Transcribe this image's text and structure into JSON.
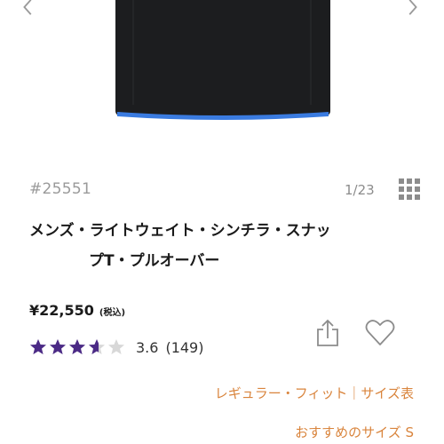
{
  "product": {
    "sku": "#25551",
    "image_counter": "1/23",
    "title_line1": "メンズ・ライトウェイト・シンチラ・スナッ",
    "title_line2": "プT・プルオーバー",
    "price": "¥22,550",
    "tax_label": "(税込)",
    "rating_value": "3.6",
    "rating_count": "(149)",
    "rating_stars": 3.6,
    "fit_link": "レギュラー・フィット｜サイズ表",
    "recommended_size": "おすすめのサイズ S"
  },
  "colors": {
    "jacket": "#1c1d1f",
    "jacket_trim": "#3a7be0",
    "star_filled": "#4b2a86",
    "star_empty": "#d8d8d8",
    "link_accent": "#d9843c"
  },
  "icons": {
    "prev": "chevron-left-icon",
    "next": "chevron-right-icon",
    "grid": "grid-icon",
    "share": "share-icon",
    "favorite": "heart-icon"
  }
}
